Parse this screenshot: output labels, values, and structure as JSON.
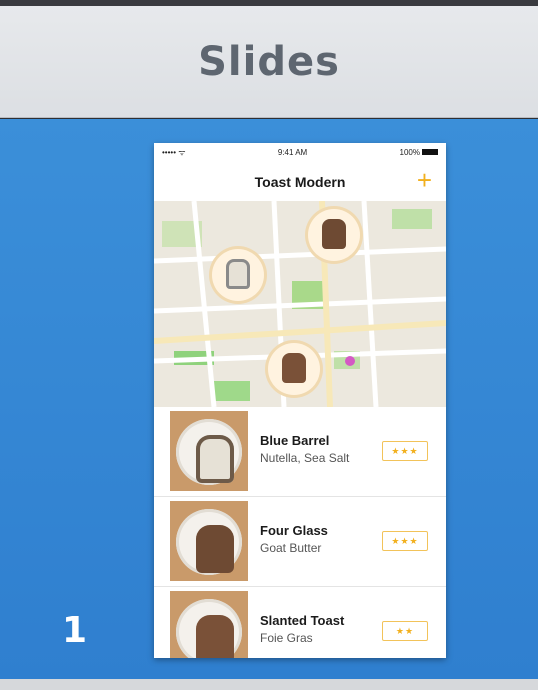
{
  "header": {
    "title": "Slides"
  },
  "slide": {
    "number": "1"
  },
  "phone": {
    "status": {
      "carrier": "••••• ᯤ",
      "time": "9:41 AM",
      "battery": "100%"
    },
    "nav": {
      "title": "Toast Modern",
      "add_label": "+"
    },
    "items": [
      {
        "name": "Blue Barrel",
        "subtitle": "Nutella, Sea Salt",
        "rating": "★★★",
        "toast_color": "#e6e1d6"
      },
      {
        "name": "Four Glass",
        "subtitle": "Goat Butter",
        "rating": "★★★",
        "toast_color": "#6e4a33"
      },
      {
        "name": "Slanted Toast",
        "subtitle": "Foie Gras",
        "rating": "★★",
        "toast_color": "#7a5138"
      }
    ]
  },
  "colors": {
    "accent": "#f2b01e",
    "panel": "#2f7fcf"
  }
}
